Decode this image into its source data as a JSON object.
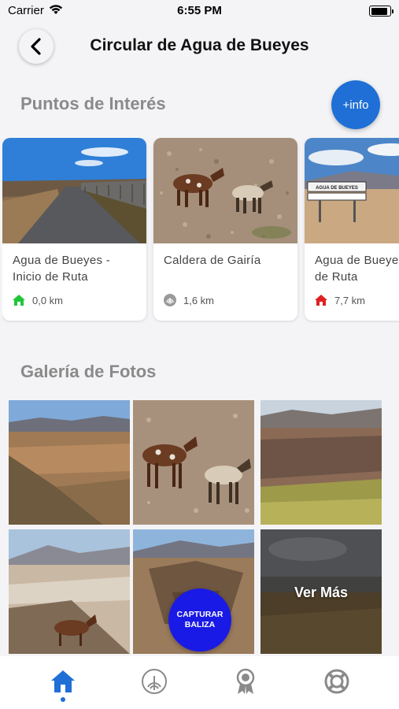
{
  "status_bar": {
    "carrier": "Carrier",
    "time": "6:55 PM"
  },
  "header": {
    "title": "Circular de Agua de Bueyes",
    "back_icon": "chevron-left-icon"
  },
  "points_section": {
    "title": "Puntos de Interés",
    "info_button": "+info",
    "cards": [
      {
        "name": "Agua de Bueyes - Inicio de Ruta",
        "distance": "0,0 km",
        "icon": "home-icon",
        "icon_color": "#22c53a"
      },
      {
        "name": "Caldera de Gairía",
        "distance": "1,6 km",
        "icon": "fingerprint-icon",
        "icon_color": "#9a9a9a"
      },
      {
        "name": "Agua de Bueyes - Fin de Ruta",
        "distance": "7,7 km",
        "icon": "home-icon",
        "icon_color": "#e02020"
      }
    ]
  },
  "gallery_section": {
    "title": "Galería de Fotos",
    "more_label": "Ver Más",
    "capture_button": "CAPTURAR BALIZA"
  },
  "tab_bar": {
    "tabs": [
      {
        "icon": "home-icon",
        "active": true
      },
      {
        "icon": "beacon-icon",
        "active": false
      },
      {
        "icon": "award-icon",
        "active": false
      },
      {
        "icon": "lifebuoy-icon",
        "active": false
      }
    ]
  },
  "colors": {
    "accent": "#1f6fd6",
    "capture": "#1a1ae6",
    "section_title": "#8a8a8a",
    "background": "#f4f4f6"
  }
}
